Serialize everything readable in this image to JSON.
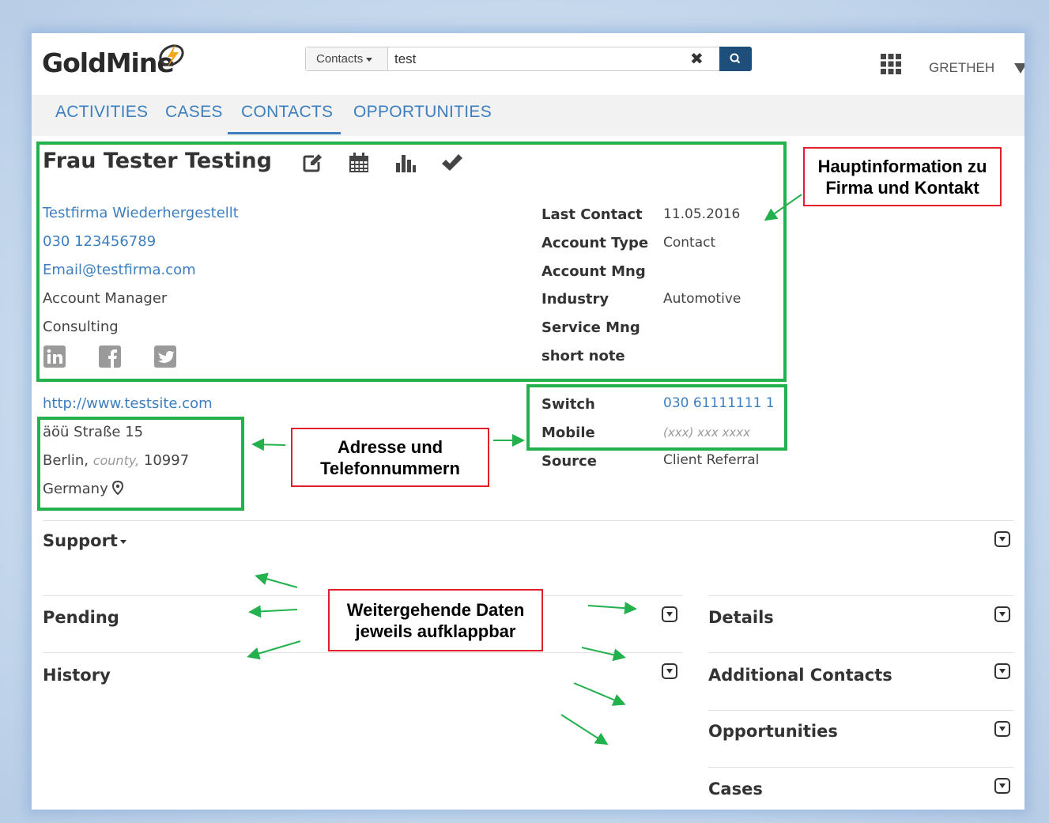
{
  "header": {
    "logo_text": "GoldMine",
    "search_type": "Contacts",
    "search_value": "test",
    "username": "GRETHEH"
  },
  "nav": {
    "items": [
      "ACTIVITIES",
      "CASES",
      "CONTACTS",
      "OPPORTUNITIES"
    ],
    "active": "CONTACTS"
  },
  "contact": {
    "name": "Frau Tester Testing",
    "company": "Testfirma Wiederhergestellt",
    "phone": "030 123456789",
    "email": "Email@testfirma.com",
    "title": "Account Manager",
    "department": "Consulting",
    "website": "http://www.testsite.com",
    "street": "äöü Straße 15",
    "city": "Berlin,",
    "county_placeholder": "county,",
    "zip": "10997",
    "country": "Germany"
  },
  "info_fields": [
    {
      "label": "Last Contact",
      "value": "11.05.2016"
    },
    {
      "label": "Account Type",
      "value": "Contact"
    },
    {
      "label": "Account Mng",
      "value": ""
    },
    {
      "label": "Industry",
      "value": "Automotive"
    },
    {
      "label": "Service Mng",
      "value": ""
    },
    {
      "label": "short note",
      "value": ""
    }
  ],
  "phone_fields": [
    {
      "label": "Switch",
      "value": "030 61111111 1"
    },
    {
      "label": "Mobile",
      "value": "(xxx) xxx xxxx"
    },
    {
      "label": "Source",
      "value": "Client Referral"
    }
  ],
  "sections": {
    "support": "Support",
    "pending": "Pending",
    "history": "History",
    "details": "Details",
    "additional_contacts": "Additional Contacts",
    "opportunities": "Opportunities",
    "cases": "Cases"
  },
  "callouts": {
    "main_info_line1": "Hauptinformation zu",
    "main_info_line2": "Firma und Kontakt",
    "address_line1": "Adresse und",
    "address_line2": "Telefonnummern",
    "more_line1": "Weitergehende Daten",
    "more_line2": "jeweils aufklappbar"
  },
  "colors": {
    "link": "#3d7ebf",
    "highlight": "#22b14c",
    "callout_border": "#e0202a",
    "search_button": "#1e4f7a"
  }
}
